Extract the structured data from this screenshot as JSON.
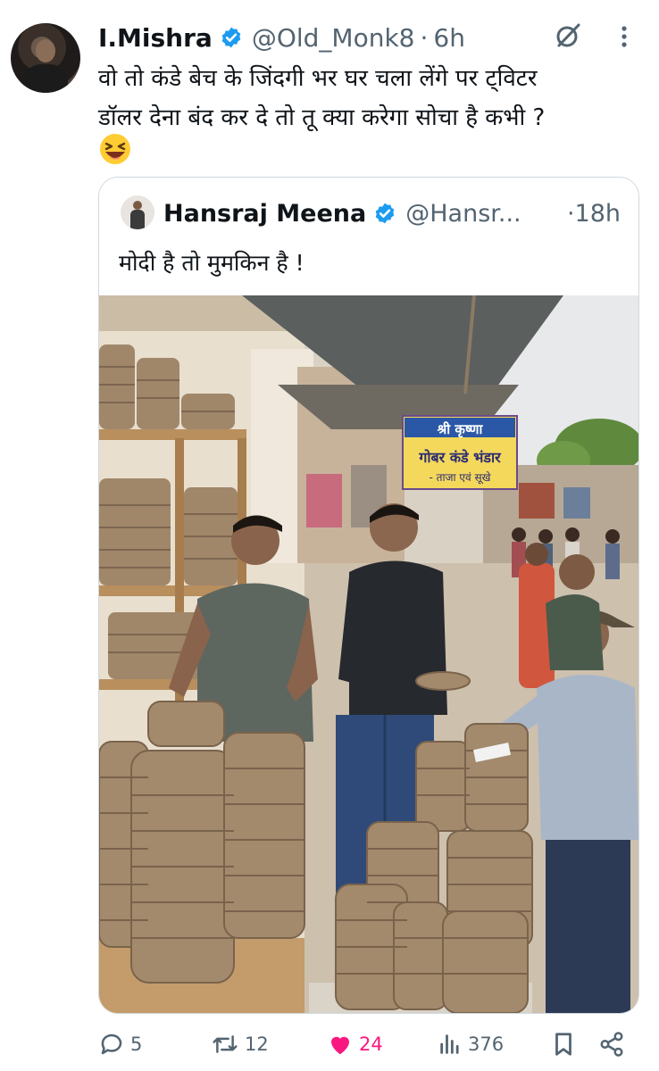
{
  "tweet": {
    "author_name": "I.Mishra",
    "handle": "@Old_Monk8",
    "separator": "·",
    "time": "6h",
    "text_line1": "वो तो कंडे बेच के जिंदगी भर घर चला लेंगे पर ट्विटर",
    "text_line2": "डॉलर देना बंद कर दे तो तू क्या करेगा सोचा है कभी ?",
    "emoji": "laughing-face"
  },
  "quote": {
    "author_name": "Hansraj Meena",
    "handle": "@Hansr...",
    "time": "·18h",
    "text": "मोदी है तो मुमकिन है !",
    "photo": {
      "sign_line1": "श्री कृष्णा",
      "sign_line2": "गोबर कंडे भंडार",
      "sign_line3": "- ताजा एवं सूखे"
    }
  },
  "actions": {
    "replies": "5",
    "retweets": "12",
    "likes": "24",
    "views": "376"
  },
  "colors": {
    "verified": "#1d9bf0",
    "like": "#f91880",
    "muted": "#536471"
  }
}
